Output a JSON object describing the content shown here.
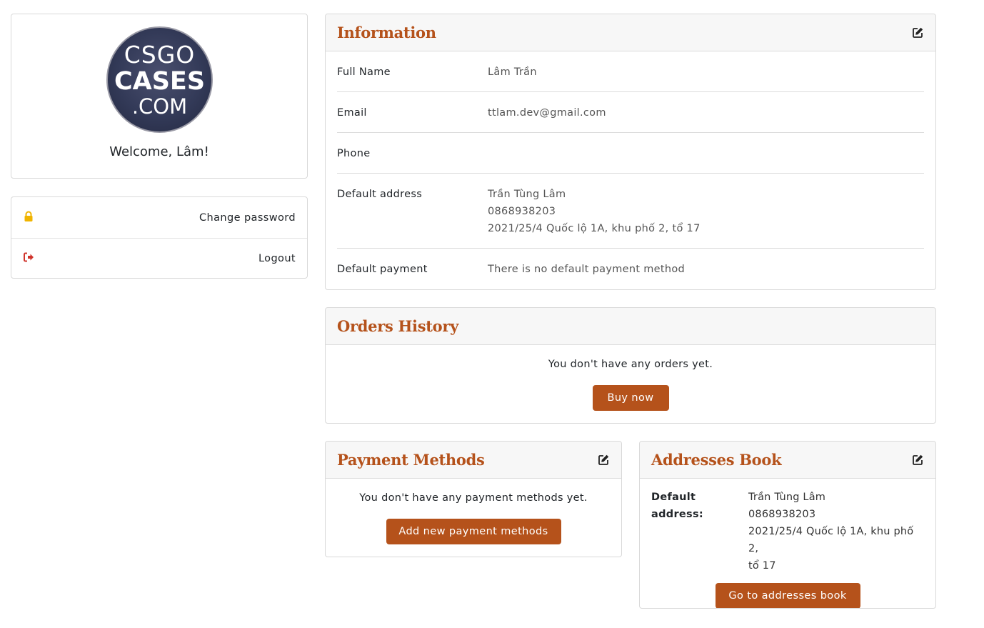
{
  "profile": {
    "logo_lines": [
      "CSGO",
      "CASES",
      ".COM"
    ],
    "welcome": "Welcome, Lâm!"
  },
  "menu": {
    "items": [
      {
        "label": "Change password",
        "icon": "lock-icon",
        "icon_color": "#f0b400"
      },
      {
        "label": "Logout",
        "icon": "sign-out-icon",
        "icon_color": "#d0342c"
      }
    ]
  },
  "information": {
    "title": "Information",
    "rows": [
      {
        "key": "Full Name",
        "value": [
          "Lâm Trần"
        ]
      },
      {
        "key": "Email",
        "value": [
          "ttlam.dev@gmail.com"
        ]
      },
      {
        "key": "Phone",
        "value": [
          ""
        ]
      },
      {
        "key": "Default address",
        "value": [
          "Trần Tùng Lâm",
          "0868938203",
          "2021/25/4 Quốc lộ 1A, khu phố 2, tổ 17"
        ]
      },
      {
        "key": "Default payment",
        "value": [
          "There is no default payment method"
        ]
      }
    ]
  },
  "orders": {
    "title": "Orders History",
    "empty_text": "You don't have any orders yet.",
    "button": "Buy now"
  },
  "payment": {
    "title": "Payment Methods",
    "empty_text": "You don't have any payment methods yet.",
    "button": "Add new payment methods"
  },
  "addresses": {
    "title": "Addresses Book",
    "key_line1": "Default",
    "key_line2": "address:",
    "name": "Trần Tùng Lâm",
    "phone": "0868938203",
    "street_line1": "2021/25/4 Quốc lộ 1A, khu phố 2,",
    "street_line2": "tổ 17",
    "button": "Go to addresses book"
  },
  "colors": {
    "accent": "#b5521b",
    "lock": "#f0b400",
    "logout": "#d0342c"
  }
}
